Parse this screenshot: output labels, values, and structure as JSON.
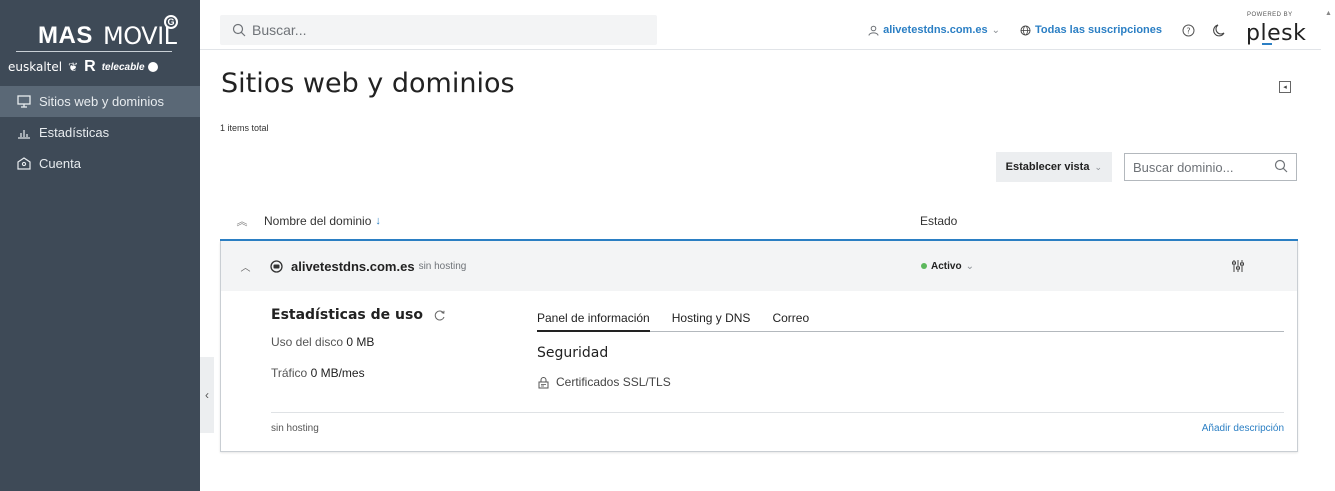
{
  "brand": {
    "logo_mas": "MAS",
    "logo_movil": "MOVIL",
    "logo_mark": "G",
    "partner_euskaltel": "euskaltel",
    "partner_r": "R",
    "partner_telecable": "telecable"
  },
  "sidebar": {
    "items": [
      {
        "label": "Sitios web y dominios",
        "icon": "monitor-icon",
        "active": true
      },
      {
        "label": "Estadísticas",
        "icon": "bar-chart-icon",
        "active": false
      },
      {
        "label": "Cuenta",
        "icon": "account-icon",
        "active": false
      }
    ]
  },
  "topbar": {
    "search_placeholder": "Buscar...",
    "user": "alivetestdns.com.es",
    "subscriptions": "Todas las suscripciones",
    "powered_by": "POWERED BY",
    "plesk": "plesk"
  },
  "main": {
    "title": "Sitios web y dominios",
    "items_total": "1 items total",
    "set_view_label": "Establecer vista",
    "domain_search_placeholder": "Buscar dominio..."
  },
  "table": {
    "col_name": "Nombre del dominio",
    "col_status": "Estado"
  },
  "domain": {
    "name": "alivetestdns.com.es",
    "hosting_type": "sin hosting",
    "status": "Activo",
    "status_color": "#5cb85c",
    "stats_title": "Estadísticas de uso",
    "disk_label": "Uso del disco",
    "disk_value": "0 MB",
    "traffic_label": "Tráfico",
    "traffic_value": "0 MB/mes",
    "tabs": [
      "Panel de información",
      "Hosting y DNS",
      "Correo"
    ],
    "security_title": "Seguridad",
    "ssl_link": "Certificados SSL/TLS",
    "footer_hosting": "sin hosting",
    "add_description": "Añadir descripción"
  },
  "colors": {
    "sidebar_bg": "#3e4a57",
    "sidebar_active": "#5a6876",
    "accent": "#2b7fc4"
  }
}
